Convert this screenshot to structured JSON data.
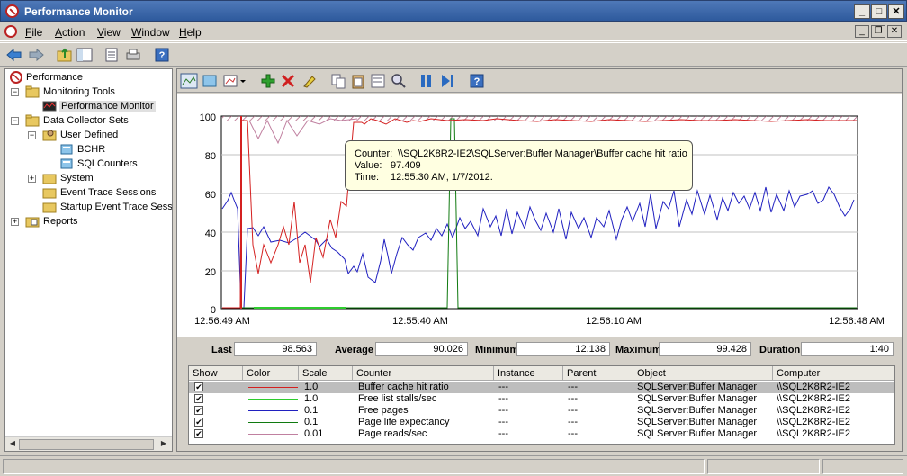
{
  "window": {
    "title": "Performance Monitor",
    "btn_min": "_",
    "btn_max": "□",
    "btn_close": "✕"
  },
  "menu": {
    "items": [
      "File",
      "Action",
      "View",
      "Window",
      "Help"
    ]
  },
  "tree": {
    "root": "Performance",
    "monitoring_tools": "Monitoring Tools",
    "performance_monitor": "Performance Monitor",
    "data_collector_sets": "Data Collector Sets",
    "user_defined": "User Defined",
    "bchr": "BCHR",
    "sqlcounters": "SQLCounters",
    "system": "System",
    "event_trace": "Event Trace Sessions",
    "startup_event_trace": "Startup Event Trace Sess",
    "reports": "Reports"
  },
  "graph": {
    "y_ticks": [
      "100",
      "80",
      "60",
      "40",
      "20",
      "0"
    ],
    "x_ticks": [
      "12:56:49 AM",
      "12:55:40 AM",
      "12:56:10 AM",
      "12:56:48 AM"
    ]
  },
  "tooltip": {
    "counter_label": "Counter:",
    "counter_value": "\\\\SQL2K8R2-IE2\\SQLServer:Buffer Manager\\Buffer cache hit ratio",
    "value_label": "Value:",
    "value_value": "97.409",
    "time_label": "Time:",
    "time_value": "12:55:30 AM, 1/7/2012."
  },
  "stats": {
    "last_label": "Last",
    "last": "98.563",
    "average_label": "Average",
    "average": "90.026",
    "minimum_label": "Minimum",
    "minimum": "12.138",
    "maximum_label": "Maximum",
    "maximum": "99.428",
    "duration_label": "Duration",
    "duration": "1:40"
  },
  "counter_table": {
    "headers": [
      "Show",
      "Color",
      "Scale",
      "Counter",
      "Instance",
      "Parent",
      "Object",
      "Computer"
    ],
    "rows": [
      {
        "scale": "1.0",
        "counter": "Buffer cache hit ratio",
        "instance": "---",
        "parent": "---",
        "object": "SQLServer:Buffer Manager",
        "computer": "\\\\SQL2K8R2-IE2",
        "color": "#d42020"
      },
      {
        "scale": "1.0",
        "counter": "Free list stalls/sec",
        "instance": "---",
        "parent": "---",
        "object": "SQLServer:Buffer Manager",
        "computer": "\\\\SQL2K8R2-IE2",
        "color": "#2ecc2e"
      },
      {
        "scale": "0.1",
        "counter": "Free pages",
        "instance": "---",
        "parent": "---",
        "object": "SQLServer:Buffer Manager",
        "computer": "\\\\SQL2K8R2-IE2",
        "color": "#2020c0"
      },
      {
        "scale": "0.1",
        "counter": "Page life expectancy",
        "instance": "---",
        "parent": "---",
        "object": "SQLServer:Buffer Manager",
        "computer": "\\\\SQL2K8R2-IE2",
        "color": "#107a10"
      },
      {
        "scale": "0.01",
        "counter": "Page reads/sec",
        "instance": "---",
        "parent": "---",
        "object": "SQLServer:Buffer Manager",
        "computer": "\\\\SQL2K8R2-IE2",
        "color": "#c080a0"
      }
    ]
  },
  "icons": [
    "back-icon",
    "forward-icon",
    "up-folder-icon",
    "show-hide-tree-icon",
    "properties-icon",
    "print-icon",
    "help-icon",
    "view-graph-icon",
    "freeze-icon",
    "change-graph-type-icon",
    "add-counter-icon",
    "delete-counter-icon",
    "highlight-icon",
    "copy-icon",
    "paste-icon",
    "properties-icon",
    "zoom-icon",
    "pause-icon",
    "update-data-icon",
    "help-icon"
  ]
}
